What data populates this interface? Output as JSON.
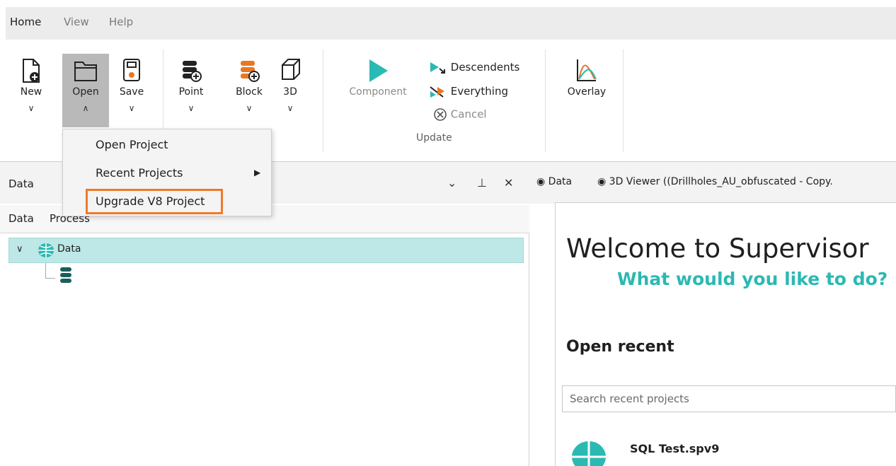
{
  "menubar": {
    "tabs": [
      {
        "label": "Home",
        "active": true
      },
      {
        "label": "View",
        "active": false
      },
      {
        "label": "Help",
        "active": false
      }
    ]
  },
  "ribbon": {
    "new": {
      "label": "New",
      "chevron": "∨"
    },
    "open": {
      "label": "Open",
      "chevron": "∧"
    },
    "save": {
      "label": "Save",
      "chevron": "∨"
    },
    "point": {
      "label": "Point",
      "chevron": "∨"
    },
    "block": {
      "label": "Block",
      "chevron": "∨"
    },
    "three_d": {
      "label": "3D",
      "chevron": "∨"
    },
    "component": {
      "label": "Component"
    },
    "descendents": {
      "label": "Descendents"
    },
    "everything": {
      "label": "Everything"
    },
    "cancel": {
      "label": "Cancel"
    },
    "update_group": {
      "label": "Update"
    },
    "overlay": {
      "label": "Overlay"
    }
  },
  "open_dropdown": {
    "items": [
      {
        "label": "Open Project"
      },
      {
        "label": "Recent Projects",
        "has_submenu": true
      },
      {
        "label": "Upgrade V8 Project",
        "highlighted": true
      }
    ],
    "highlight_color": "#f07a28"
  },
  "left_panel": {
    "title": "Data",
    "subtabs": [
      "Data",
      "Process"
    ],
    "tree": {
      "root_label": "Data"
    }
  },
  "right_panel": {
    "tabs": [
      {
        "label": "Data"
      },
      {
        "label": "3D Viewer ((Drillholes_AU_obfuscated - Copy."
      }
    ],
    "welcome_title": "Welcome to Supervisor",
    "welcome_subtitle": "What would you like to do?",
    "open_recent": "Open recent",
    "search_placeholder": "Search recent projects",
    "recent_items": [
      {
        "name": "SQL Test.spv9"
      }
    ]
  },
  "colors": {
    "accent_teal": "#2bb9b3",
    "selection": "#bde8e7",
    "orange_icon": "#e87722"
  }
}
